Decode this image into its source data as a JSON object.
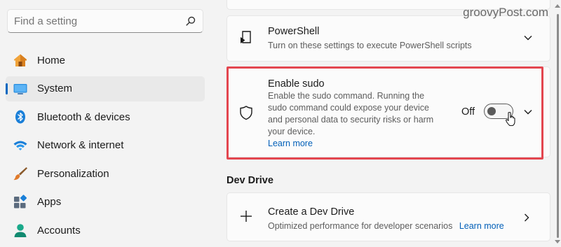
{
  "search": {
    "placeholder": "Find a setting"
  },
  "sidebar": {
    "items": [
      {
        "label": "Home",
        "icon": "home-icon",
        "active": false
      },
      {
        "label": "System",
        "icon": "system-icon",
        "active": true
      },
      {
        "label": "Bluetooth & devices",
        "icon": "bluetooth-icon",
        "active": false
      },
      {
        "label": "Network & internet",
        "icon": "wifi-icon",
        "active": false
      },
      {
        "label": "Personalization",
        "icon": "brush-icon",
        "active": false
      },
      {
        "label": "Apps",
        "icon": "apps-icon",
        "active": false
      },
      {
        "label": "Accounts",
        "icon": "accounts-icon",
        "active": false
      }
    ]
  },
  "powershell": {
    "title": "PowerShell",
    "description": "Turn on these settings to execute PowerShell scripts"
  },
  "sudo": {
    "title": "Enable sudo",
    "description_lines": [
      "Enable the sudo command. Running the",
      "sudo command could expose your device",
      "and personal data to security risks or harm",
      "your device."
    ],
    "learn_more": "Learn more",
    "toggle_state": "Off"
  },
  "dev_drive": {
    "heading": "Dev Drive",
    "title": "Create a Dev Drive",
    "description": "Optimized performance for developer scenarios",
    "learn_more": "Learn more"
  },
  "watermark": "groovyPost.com",
  "colors": {
    "accent": "#0067c0",
    "link": "#005fb8",
    "highlight": "#e3464f"
  }
}
